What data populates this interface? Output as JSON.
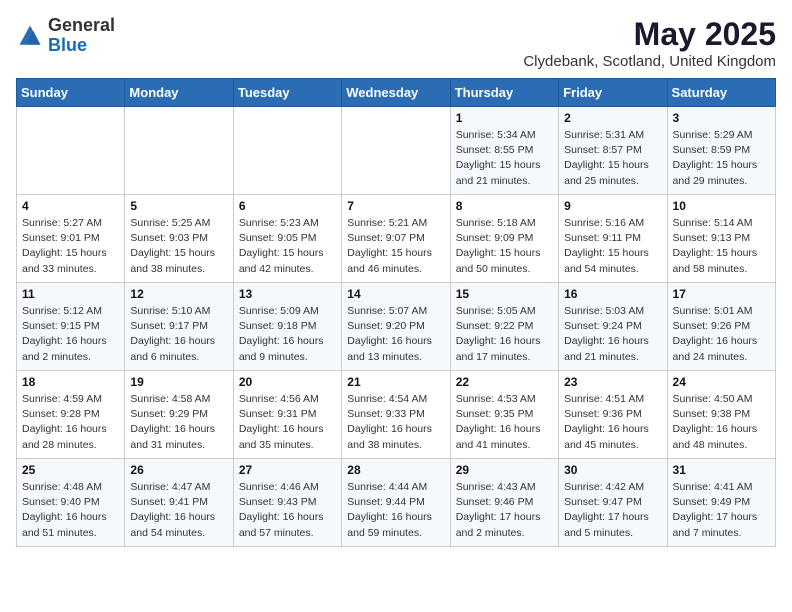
{
  "header": {
    "logo_line1": "General",
    "logo_line2": "Blue",
    "title": "May 2025",
    "subtitle": "Clydebank, Scotland, United Kingdom"
  },
  "weekdays": [
    "Sunday",
    "Monday",
    "Tuesday",
    "Wednesday",
    "Thursday",
    "Friday",
    "Saturday"
  ],
  "weeks": [
    [
      {
        "day": "",
        "info": ""
      },
      {
        "day": "",
        "info": ""
      },
      {
        "day": "",
        "info": ""
      },
      {
        "day": "",
        "info": ""
      },
      {
        "day": "1",
        "info": "Sunrise: 5:34 AM\nSunset: 8:55 PM\nDaylight: 15 hours\nand 21 minutes."
      },
      {
        "day": "2",
        "info": "Sunrise: 5:31 AM\nSunset: 8:57 PM\nDaylight: 15 hours\nand 25 minutes."
      },
      {
        "day": "3",
        "info": "Sunrise: 5:29 AM\nSunset: 8:59 PM\nDaylight: 15 hours\nand 29 minutes."
      }
    ],
    [
      {
        "day": "4",
        "info": "Sunrise: 5:27 AM\nSunset: 9:01 PM\nDaylight: 15 hours\nand 33 minutes."
      },
      {
        "day": "5",
        "info": "Sunrise: 5:25 AM\nSunset: 9:03 PM\nDaylight: 15 hours\nand 38 minutes."
      },
      {
        "day": "6",
        "info": "Sunrise: 5:23 AM\nSunset: 9:05 PM\nDaylight: 15 hours\nand 42 minutes."
      },
      {
        "day": "7",
        "info": "Sunrise: 5:21 AM\nSunset: 9:07 PM\nDaylight: 15 hours\nand 46 minutes."
      },
      {
        "day": "8",
        "info": "Sunrise: 5:18 AM\nSunset: 9:09 PM\nDaylight: 15 hours\nand 50 minutes."
      },
      {
        "day": "9",
        "info": "Sunrise: 5:16 AM\nSunset: 9:11 PM\nDaylight: 15 hours\nand 54 minutes."
      },
      {
        "day": "10",
        "info": "Sunrise: 5:14 AM\nSunset: 9:13 PM\nDaylight: 15 hours\nand 58 minutes."
      }
    ],
    [
      {
        "day": "11",
        "info": "Sunrise: 5:12 AM\nSunset: 9:15 PM\nDaylight: 16 hours\nand 2 minutes."
      },
      {
        "day": "12",
        "info": "Sunrise: 5:10 AM\nSunset: 9:17 PM\nDaylight: 16 hours\nand 6 minutes."
      },
      {
        "day": "13",
        "info": "Sunrise: 5:09 AM\nSunset: 9:18 PM\nDaylight: 16 hours\nand 9 minutes."
      },
      {
        "day": "14",
        "info": "Sunrise: 5:07 AM\nSunset: 9:20 PM\nDaylight: 16 hours\nand 13 minutes."
      },
      {
        "day": "15",
        "info": "Sunrise: 5:05 AM\nSunset: 9:22 PM\nDaylight: 16 hours\nand 17 minutes."
      },
      {
        "day": "16",
        "info": "Sunrise: 5:03 AM\nSunset: 9:24 PM\nDaylight: 16 hours\nand 21 minutes."
      },
      {
        "day": "17",
        "info": "Sunrise: 5:01 AM\nSunset: 9:26 PM\nDaylight: 16 hours\nand 24 minutes."
      }
    ],
    [
      {
        "day": "18",
        "info": "Sunrise: 4:59 AM\nSunset: 9:28 PM\nDaylight: 16 hours\nand 28 minutes."
      },
      {
        "day": "19",
        "info": "Sunrise: 4:58 AM\nSunset: 9:29 PM\nDaylight: 16 hours\nand 31 minutes."
      },
      {
        "day": "20",
        "info": "Sunrise: 4:56 AM\nSunset: 9:31 PM\nDaylight: 16 hours\nand 35 minutes."
      },
      {
        "day": "21",
        "info": "Sunrise: 4:54 AM\nSunset: 9:33 PM\nDaylight: 16 hours\nand 38 minutes."
      },
      {
        "day": "22",
        "info": "Sunrise: 4:53 AM\nSunset: 9:35 PM\nDaylight: 16 hours\nand 41 minutes."
      },
      {
        "day": "23",
        "info": "Sunrise: 4:51 AM\nSunset: 9:36 PM\nDaylight: 16 hours\nand 45 minutes."
      },
      {
        "day": "24",
        "info": "Sunrise: 4:50 AM\nSunset: 9:38 PM\nDaylight: 16 hours\nand 48 minutes."
      }
    ],
    [
      {
        "day": "25",
        "info": "Sunrise: 4:48 AM\nSunset: 9:40 PM\nDaylight: 16 hours\nand 51 minutes."
      },
      {
        "day": "26",
        "info": "Sunrise: 4:47 AM\nSunset: 9:41 PM\nDaylight: 16 hours\nand 54 minutes."
      },
      {
        "day": "27",
        "info": "Sunrise: 4:46 AM\nSunset: 9:43 PM\nDaylight: 16 hours\nand 57 minutes."
      },
      {
        "day": "28",
        "info": "Sunrise: 4:44 AM\nSunset: 9:44 PM\nDaylight: 16 hours\nand 59 minutes."
      },
      {
        "day": "29",
        "info": "Sunrise: 4:43 AM\nSunset: 9:46 PM\nDaylight: 17 hours\nand 2 minutes."
      },
      {
        "day": "30",
        "info": "Sunrise: 4:42 AM\nSunset: 9:47 PM\nDaylight: 17 hours\nand 5 minutes."
      },
      {
        "day": "31",
        "info": "Sunrise: 4:41 AM\nSunset: 9:49 PM\nDaylight: 17 hours\nand 7 minutes."
      }
    ]
  ]
}
